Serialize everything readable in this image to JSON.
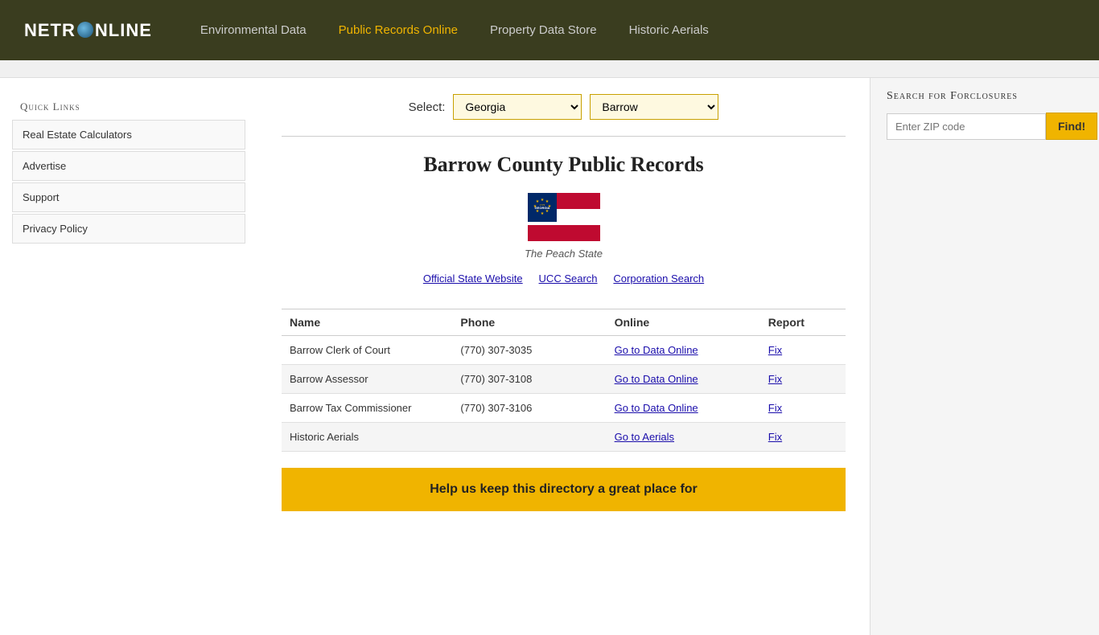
{
  "header": {
    "logo_text_1": "NETR",
    "logo_text_2": "NLINE",
    "nav_items": [
      {
        "label": "Environmental Data",
        "active": false
      },
      {
        "label": "Public Records Online",
        "active": true
      },
      {
        "label": "Property Data Store",
        "active": false
      },
      {
        "label": "Historic Aerials",
        "active": false
      }
    ]
  },
  "sidebar": {
    "quick_links_title": "Quick Links",
    "items": [
      {
        "label": "Real Estate Calculators"
      },
      {
        "label": "Advertise"
      },
      {
        "label": "Support"
      },
      {
        "label": "Privacy Policy"
      }
    ]
  },
  "select": {
    "label": "Select:",
    "state_value": "Georgia",
    "county_value": "Barrow",
    "state_options": [
      "Georgia"
    ],
    "county_options": [
      "Barrow"
    ]
  },
  "page": {
    "title": "Barrow County Public Records",
    "flag_caption": "The Peach State",
    "state_links": [
      {
        "label": "Official State Website"
      },
      {
        "label": "UCC Search"
      },
      {
        "label": "Corporation Search"
      }
    ]
  },
  "table": {
    "headers": [
      "Name",
      "Phone",
      "Online",
      "Report"
    ],
    "rows": [
      {
        "name": "Barrow Clerk of Court",
        "phone": "(770) 307-3035",
        "online_label": "Go to Data Online",
        "report_label": "Fix"
      },
      {
        "name": "Barrow Assessor",
        "phone": "(770) 307-3108",
        "online_label": "Go to Data Online",
        "report_label": "Fix"
      },
      {
        "name": "Barrow Tax Commissioner",
        "phone": "(770) 307-3106",
        "online_label": "Go to Data Online",
        "report_label": "Fix"
      },
      {
        "name": "Historic Aerials",
        "phone": "",
        "online_label": "Go to Aerials",
        "report_label": "Fix"
      }
    ]
  },
  "yellow_banner": {
    "text": "Help us keep this directory a great place for"
  },
  "right_sidebar": {
    "foreclosure_title": "Search for Forclosures",
    "zip_placeholder": "Enter ZIP code",
    "find_button_label": "Find!"
  }
}
